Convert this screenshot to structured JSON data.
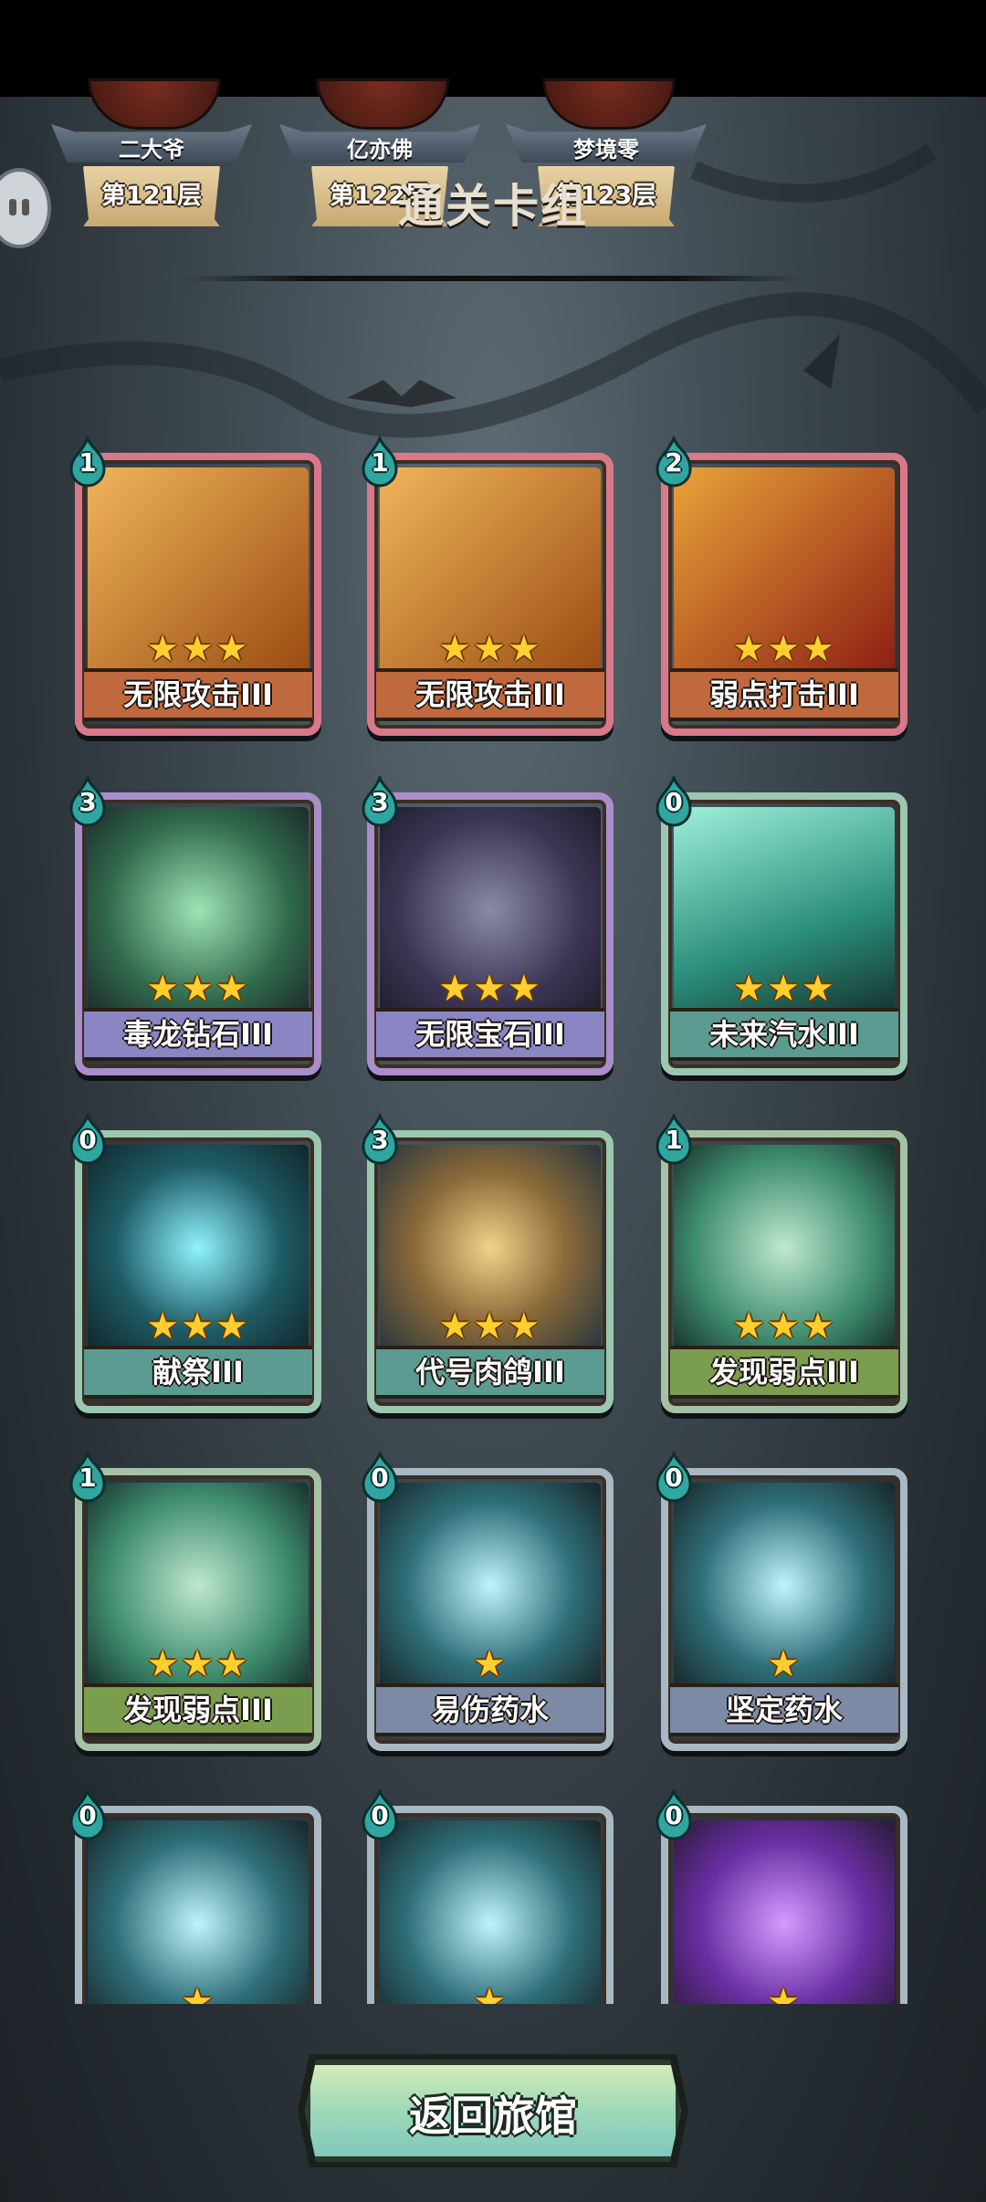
{
  "players": [
    {
      "name": "二大爷",
      "floor": "第121层"
    },
    {
      "name": "亿亦佛",
      "floor": "第122层"
    },
    {
      "name": "梦境零",
      "floor": "第123层"
    }
  ],
  "section_title": "通关卡组",
  "cards": [
    {
      "name": "无限攻击III",
      "cost": "1",
      "stars": "★★★",
      "theme": "red",
      "art": "swords-icon"
    },
    {
      "name": "无限攻击III",
      "cost": "1",
      "stars": "★★★",
      "theme": "red",
      "art": "swords-icon"
    },
    {
      "name": "弱点打击III",
      "cost": "2",
      "stars": "★★★",
      "theme": "red",
      "art": "weak-strike-icon"
    },
    {
      "name": "毒龙钻石III",
      "cost": "3",
      "stars": "★★★",
      "theme": "purple",
      "art": "dragon-diamond-icon"
    },
    {
      "name": "无限宝石III",
      "cost": "3",
      "stars": "★★★",
      "theme": "purple",
      "art": "infinity-gem-icon"
    },
    {
      "name": "未来汽水III",
      "cost": "0",
      "stars": "★★★",
      "theme": "teal",
      "art": "soda-bottle-icon"
    },
    {
      "name": "献祭III",
      "cost": "0",
      "stars": "★★★",
      "theme": "teal",
      "art": "sacrifice-icon"
    },
    {
      "name": "代号肉鸽III",
      "cost": "3",
      "stars": "★★★",
      "theme": "teal",
      "art": "roguelike-icon"
    },
    {
      "name": "发现弱点III",
      "cost": "1",
      "stars": "★★★",
      "theme": "green",
      "art": "target-robot-icon"
    },
    {
      "name": "发现弱点III",
      "cost": "1",
      "stars": "★★★",
      "theme": "green",
      "art": "target-robot-icon"
    },
    {
      "name": "易伤药水",
      "cost": "0",
      "stars": "★",
      "theme": "grey",
      "art": "potion-icon"
    },
    {
      "name": "坚定药水",
      "cost": "0",
      "stars": "★",
      "theme": "grey",
      "art": "potion-icon"
    },
    {
      "name": "",
      "cost": "0",
      "stars": "★",
      "theme": "grey",
      "art": "potion-icon"
    },
    {
      "name": "",
      "cost": "0",
      "stars": "★",
      "theme": "grey",
      "art": "potion-icon"
    },
    {
      "name": "",
      "cost": "0",
      "stars": "★",
      "theme": "grey",
      "art": "purple-potion-icon"
    }
  ],
  "return_button": "返回旅馆",
  "colors": {
    "accent_gold": "#ffcf2e",
    "cost_teal": "#2fa6a0"
  }
}
